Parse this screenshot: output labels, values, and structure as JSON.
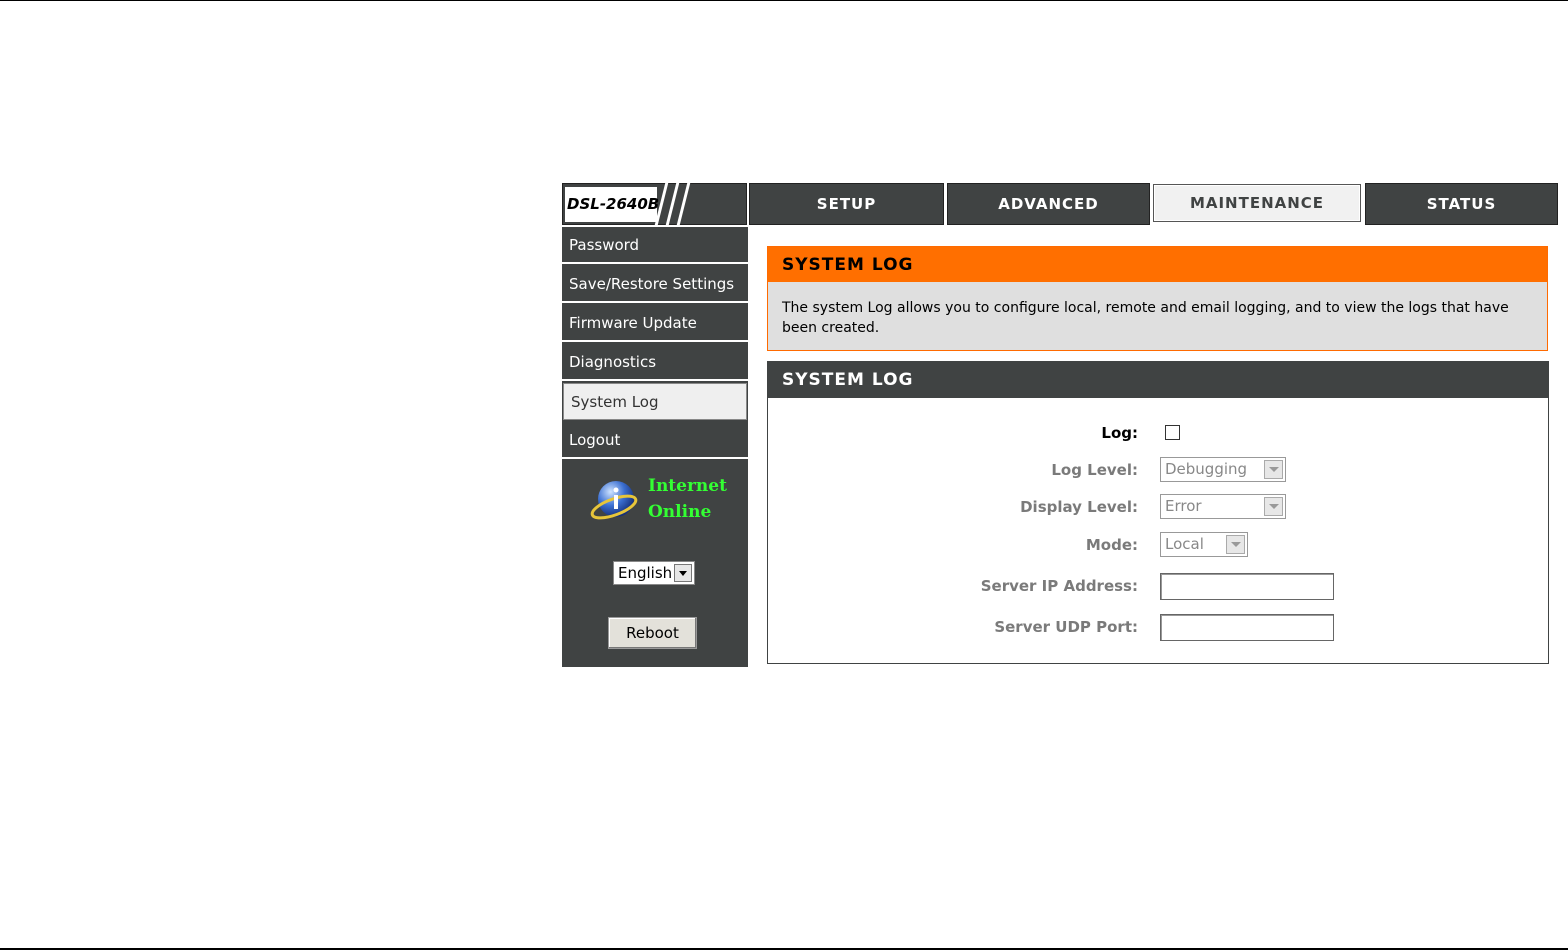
{
  "brand": {
    "model": "DSL-2640B"
  },
  "top_nav": {
    "tabs": [
      {
        "label": "SETUP",
        "active": false
      },
      {
        "label": "ADVANCED",
        "active": false
      },
      {
        "label": "MAINTENANCE",
        "active": true
      },
      {
        "label": "STATUS",
        "active": false
      }
    ]
  },
  "sidebar": {
    "items": [
      {
        "label": "Password",
        "active": false
      },
      {
        "label": "Save/Restore Settings",
        "active": false
      },
      {
        "label": "Firmware Update",
        "active": false
      },
      {
        "label": "Diagnostics",
        "active": false
      },
      {
        "label": "System Log",
        "active": true
      },
      {
        "label": "Logout",
        "active": false
      }
    ],
    "internet_status": {
      "line1": "Internet",
      "line2": "Online",
      "icon": "globe-info-icon"
    },
    "language": {
      "selected": "English"
    },
    "reboot_label": "Reboot"
  },
  "info_panel": {
    "title": "SYSTEM LOG",
    "description": "The system Log allows you to configure local, remote and email logging, and to view the logs that have been created."
  },
  "form_panel": {
    "title": "SYSTEM LOG",
    "log": {
      "label": "Log:",
      "checked": false
    },
    "log_level": {
      "label": "Log Level:",
      "value": "Debugging"
    },
    "display_level": {
      "label": "Display Level:",
      "value": "Error"
    },
    "mode": {
      "label": "Mode:",
      "value": "Local"
    },
    "server_ip": {
      "label": "Server IP Address:",
      "value": ""
    },
    "server_udp_port": {
      "label": "Server UDP Port:",
      "value": ""
    }
  },
  "colors": {
    "nav_dark": "#404343",
    "accent_orange": "#ff6f00",
    "status_green": "#33ff33"
  }
}
